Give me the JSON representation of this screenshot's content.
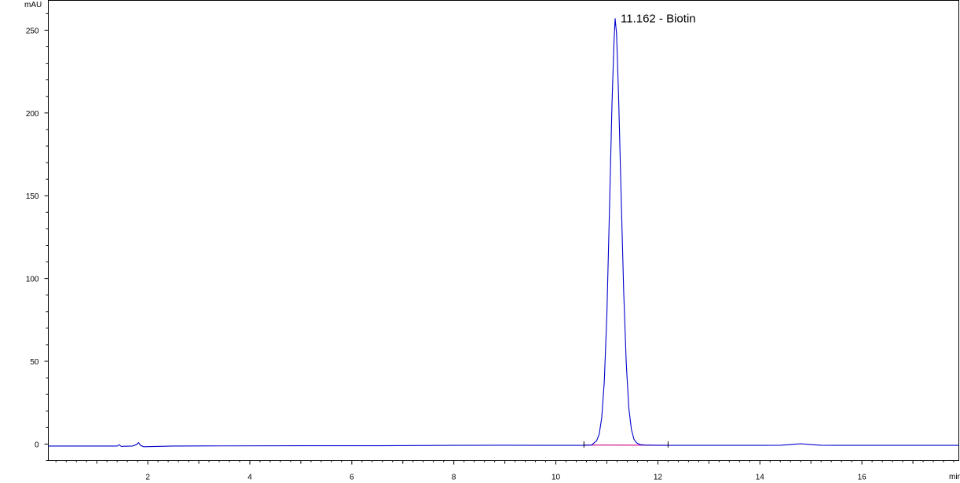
{
  "chart_data": {
    "type": "line",
    "xlabel": "min",
    "ylabel": "mAU",
    "xlim": [
      0.05,
      17.9
    ],
    "ylim": [
      -10,
      268
    ],
    "x_ticks": [
      2,
      4,
      6,
      8,
      10,
      12,
      14,
      16
    ],
    "y_ticks": [
      0,
      50,
      100,
      150,
      200,
      250
    ],
    "grid": false,
    "series": [
      {
        "color": "#0000cc",
        "x": [
          0.05,
          1.0,
          1.4,
          1.44,
          1.48,
          1.55,
          1.7,
          1.78,
          1.82,
          1.86,
          1.92,
          2.5,
          3.5,
          5.0,
          6.5,
          8.0,
          9.0,
          10.0,
          10.5,
          10.7,
          10.8,
          10.85,
          10.9,
          10.95,
          11.0,
          11.05,
          11.1,
          11.14,
          11.162,
          11.19,
          11.23,
          11.28,
          11.33,
          11.38,
          11.43,
          11.48,
          11.53,
          11.58,
          11.65,
          11.75,
          11.9,
          12.2,
          13.0,
          14.0,
          14.4,
          14.6,
          14.8,
          15.0,
          15.2,
          15.5,
          16.5,
          17.9
        ],
        "y": [
          -1.2,
          -1.2,
          -1.2,
          -0.4,
          -1.4,
          -1.3,
          -1.2,
          -0.3,
          0.9,
          -0.9,
          -1.6,
          -1.2,
          -1.1,
          -1.0,
          -1.0,
          -0.8,
          -0.7,
          -0.8,
          -0.8,
          -0.6,
          2,
          6,
          16,
          38,
          78,
          140,
          205,
          243,
          257,
          248,
          210,
          150,
          92,
          49,
          22,
          9,
          3,
          0.8,
          -0.3,
          -0.6,
          -0.7,
          -0.8,
          -0.8,
          -0.8,
          -0.7,
          -0.3,
          0.2,
          -0.3,
          -0.7,
          -0.8,
          -0.8,
          -0.8
        ]
      },
      {
        "color": "#cc0088",
        "x": [
          10.55,
          12.2
        ],
        "y": [
          -0.6,
          -0.7
        ]
      }
    ],
    "annotations": [
      {
        "x": 11.162,
        "y": 257,
        "text": "11.162 -  Biotin"
      }
    ],
    "peak_marks": [
      10.55,
      12.2
    ]
  }
}
